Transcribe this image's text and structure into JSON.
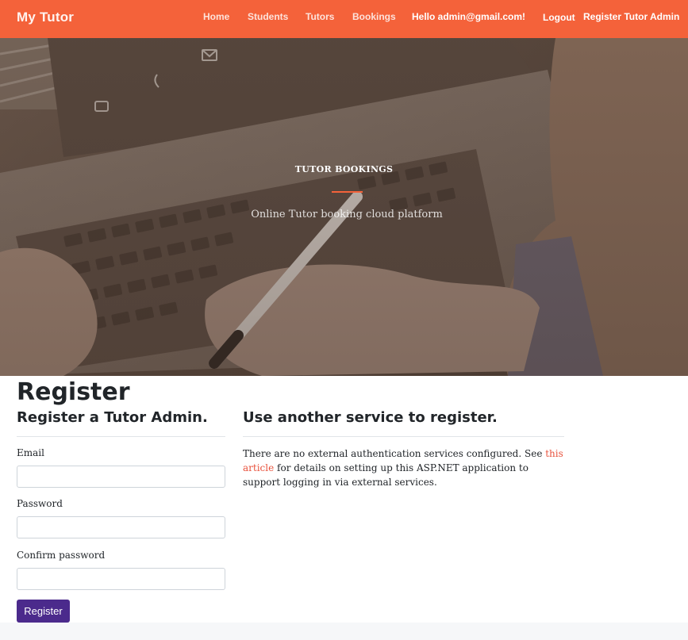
{
  "navbar": {
    "brand": "My Tutor",
    "links": [
      "Home",
      "Students",
      "Tutors",
      "Bookings"
    ],
    "greeting": "Hello admin@gmail.com!",
    "logout": "Logout",
    "register_admin": "Register Tutor Admin",
    "accent_color": "#f4623a"
  },
  "hero": {
    "title": "TUTOR BOOKINGS",
    "subtitle": "Online Tutor booking cloud platform"
  },
  "page": {
    "title": "Register",
    "form_heading": "Register a Tutor Admin.",
    "external_heading": "Use another service to register."
  },
  "form": {
    "email_label": "Email",
    "email_value": "",
    "password_label": "Password",
    "password_value": "",
    "confirm_label": "Confirm password",
    "confirm_value": "",
    "submit_label": "Register",
    "button_color": "#4b2a8c"
  },
  "external": {
    "text_before": "There are no external authentication services configured. See ",
    "link_text": "this article",
    "text_after": " for details on setting up this ASP.NET application to support logging in via external services."
  }
}
